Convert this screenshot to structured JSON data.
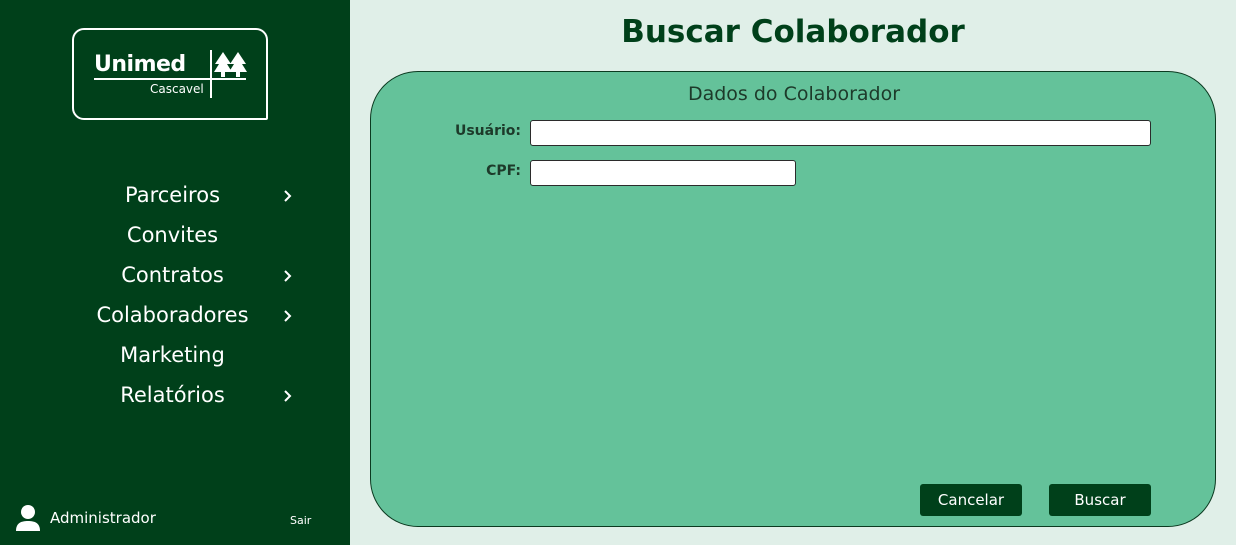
{
  "logo": {
    "wordmark": "Unimed",
    "city": "Cascavel",
    "mark_icon": "unimed-trees-icon"
  },
  "menu": [
    {
      "label": "Parceiros",
      "has_submenu": true
    },
    {
      "label": "Convites",
      "has_submenu": false
    },
    {
      "label": "Contratos",
      "has_submenu": true
    },
    {
      "label": "Colaboradores",
      "has_submenu": true
    },
    {
      "label": "Marketing",
      "has_submenu": false
    },
    {
      "label": "Relatórios",
      "has_submenu": true
    }
  ],
  "user": {
    "name": "Administrador",
    "icon": "user-icon",
    "logout_label": "Sair"
  },
  "page": {
    "title": "Buscar Colaborador"
  },
  "form": {
    "section_title": "Dados do Colaborador",
    "usuario": {
      "label": "Usuário:",
      "value": ""
    },
    "cpf": {
      "label": "CPF:",
      "value": ""
    },
    "cancel_label": "Cancelar",
    "search_label": "Buscar"
  },
  "colors": {
    "sidebar": "#00401a",
    "background": "#e0efe8",
    "panel": "#64c29a",
    "button": "#00401a"
  }
}
